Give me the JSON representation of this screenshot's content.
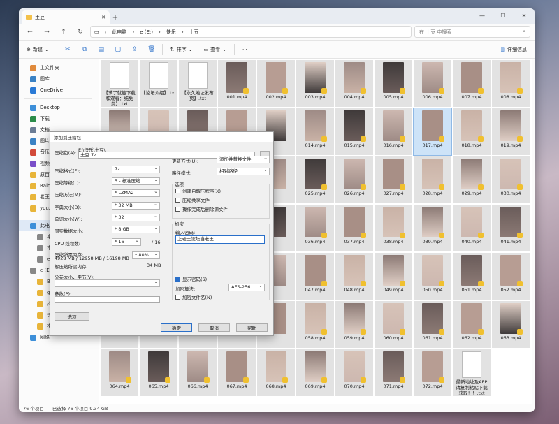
{
  "window": {
    "tab_title": "土豆",
    "new_tab": "+",
    "min": "—",
    "max": "☐",
    "close": "✕"
  },
  "address": {
    "crumbs": [
      "此电脑",
      "e (E:)",
      "快乐",
      "土豆"
    ],
    "search_placeholder": "在 土豆 中搜索"
  },
  "toolbar": {
    "new_label": "新建",
    "sort_label": "排序",
    "view_label": "查看",
    "more": "···",
    "details_label": "详细信息"
  },
  "sidebar": {
    "items": [
      {
        "label": "主文件夹",
        "color": "#e08a3c",
        "cls": "sitem"
      },
      {
        "label": "图库",
        "color": "#3b82c4",
        "cls": "sitem"
      },
      {
        "label": "OneDrive",
        "color": "#2a7ad6",
        "cls": "sitem sub2"
      },
      {
        "label": "Desktop",
        "color": "#3d8fd9",
        "cls": "sitem"
      },
      {
        "label": "下载",
        "color": "#2b8c4a",
        "cls": "sitem"
      },
      {
        "label": "文档",
        "color": "#6b7c95",
        "cls": "sitem"
      },
      {
        "label": "图片",
        "color": "#3b82c4",
        "cls": "sitem"
      },
      {
        "label": "音乐",
        "color": "#d24a3a",
        "cls": "sitem"
      },
      {
        "label": "视频",
        "color": "#7a4fc9",
        "cls": "sitem"
      },
      {
        "label": "原百",
        "color": "#e8b53a",
        "cls": "sitem"
      },
      {
        "label": "Baidu",
        "color": "#e8b53a",
        "cls": "sitem"
      },
      {
        "label": "老王的",
        "color": "#e8b53a",
        "cls": "sitem"
      },
      {
        "label": "youxi",
        "color": "#e8b53a",
        "cls": "sitem"
      },
      {
        "label": "此电脑",
        "color": "#3d8fd9",
        "cls": "sitem sel"
      },
      {
        "label": "本地磁",
        "color": "#888",
        "cls": "sitem sub"
      },
      {
        "label": "本地磁",
        "color": "#888",
        "cls": "sitem sub"
      },
      {
        "label": "e (E:)",
        "color": "#888",
        "cls": "sitem sub"
      },
      {
        "label": "e (E:)",
        "color": "#888",
        "cls": "sitem sub2"
      },
      {
        "label": "Baid",
        "color": "#e8b53a",
        "cls": "sitem sub"
      },
      {
        "label": "game",
        "color": "#e8b53a",
        "cls": "sitem sub"
      },
      {
        "label": "抖音",
        "color": "#e8b53a",
        "cls": "sitem sub"
      },
      {
        "label": "快乐",
        "color": "#e8b53a",
        "cls": "sitem sub"
      },
      {
        "label": "推特",
        "color": "#e8b53a",
        "cls": "sitem sub"
      },
      {
        "label": "网络",
        "color": "#3d8fd9",
        "cls": "sitem sub2"
      }
    ]
  },
  "files": [
    {
      "name": "【求了就能下载\n和观看：纯免\n费】.txt",
      "kind": "doc"
    },
    {
      "name": "【论坛介绍】.txt",
      "kind": "doc"
    },
    {
      "name": "【永久地址发布\n页】.txt",
      "kind": "doc"
    },
    {
      "name": "001.mp4"
    },
    {
      "name": "002.mp4"
    },
    {
      "name": "003.mp4"
    },
    {
      "name": "004.mp4"
    },
    {
      "name": "005.mp4"
    },
    {
      "name": "006.mp4"
    },
    {
      "name": "007.mp4"
    },
    {
      "name": "008.mp4"
    },
    {
      "name": ""
    },
    {
      "name": ""
    },
    {
      "name": ""
    },
    {
      "name": ""
    },
    {
      "name": ""
    },
    {
      "name": "014.mp4"
    },
    {
      "name": "015.mp4"
    },
    {
      "name": "016.mp4"
    },
    {
      "name": "017.mp4",
      "selected": true
    },
    {
      "name": "018.mp4"
    },
    {
      "name": "019.mp4"
    },
    {
      "name": ""
    },
    {
      "name": ""
    },
    {
      "name": ""
    },
    {
      "name": ""
    },
    {
      "name": ""
    },
    {
      "name": "025.mp4"
    },
    {
      "name": "026.mp4"
    },
    {
      "name": "027.mp4"
    },
    {
      "name": "028.mp4"
    },
    {
      "name": "029.mp4"
    },
    {
      "name": "030.mp4"
    },
    {
      "name": ""
    },
    {
      "name": ""
    },
    {
      "name": ""
    },
    {
      "name": ""
    },
    {
      "name": ""
    },
    {
      "name": "036.mp4"
    },
    {
      "name": "037.mp4"
    },
    {
      "name": "038.mp4"
    },
    {
      "name": "039.mp4"
    },
    {
      "name": "040.mp4"
    },
    {
      "name": "041.mp4"
    },
    {
      "name": ""
    },
    {
      "name": ""
    },
    {
      "name": ""
    },
    {
      "name": ""
    },
    {
      "name": ""
    },
    {
      "name": "047.mp4"
    },
    {
      "name": "048.mp4"
    },
    {
      "name": "049.mp4"
    },
    {
      "name": "050.mp4"
    },
    {
      "name": "051.mp4"
    },
    {
      "name": "052.mp4"
    },
    {
      "name": ""
    },
    {
      "name": ""
    },
    {
      "name": ""
    },
    {
      "name": ""
    },
    {
      "name": ""
    },
    {
      "name": "058.mp4"
    },
    {
      "name": "059.mp4"
    },
    {
      "name": "060.mp4"
    },
    {
      "name": "061.mp4"
    },
    {
      "name": "062.mp4"
    },
    {
      "name": "063.mp4"
    },
    {
      "name": "064.mp4"
    },
    {
      "name": "065.mp4"
    },
    {
      "name": "066.mp4"
    },
    {
      "name": "067.mp4"
    },
    {
      "name": "068.mp4"
    },
    {
      "name": "069.mp4"
    },
    {
      "name": "070.mp4"
    },
    {
      "name": "071.mp4"
    },
    {
      "name": "072.mp4"
    },
    {
      "name": "最新地址及APP\n请复制粘贴下载\n获取！！.txt",
      "kind": "doc"
    }
  ],
  "status": {
    "count": "76 个项目",
    "selected": "已选择 76 个项目  9.34 GB"
  },
  "dialog": {
    "title": "添加到压缩包",
    "archive_label": "压缩包(A):",
    "archive_path": "E:\\快乐\\土豆\\",
    "archive_name": "土豆.7z",
    "browse": "...",
    "format_label": "压缩格式(F):",
    "format_value": "7z",
    "level_label": "压缩等级(L):",
    "level_value": "5 - 标准压缩",
    "method_label": "压缩方法(M):",
    "method_value": "* LZMA2",
    "dict_label": "字典大小(D):",
    "dict_value": "* 32 MB",
    "word_label": "单词大小(W):",
    "word_value": "* 32",
    "solid_label": "固实数据大小:",
    "solid_value": "* 8 GB",
    "cpu_label": "CPU 线程数:",
    "cpu_value": "* 16",
    "cpu_total": "/ 16",
    "mem_label": "压缩所需内存:",
    "mem_detail": "4928 MB / 12958 MB / 16198 MB",
    "mem_pct": "* 80%",
    "dmem_label": "解压缩所需内存:",
    "dmem_value": "34 MB",
    "split_label": "分卷大小，字节(V):",
    "params_label": "参数(P):",
    "options_btn": "选项",
    "update_label": "更新方式(U):",
    "update_value": "添加并替换文件",
    "path_label": "路径模式:",
    "path_value": "相对路径",
    "opts_title": "选项",
    "opt1": "创建自解压程序(X)",
    "opt2": "压缩共享文件",
    "opt3": "操作完成后删除源文件",
    "enc_title": "加密",
    "pwd_label": "输入密码:",
    "pwd_value": "上老王论坛当老王",
    "show_pwd": "显示密码(S)",
    "enc_method_label": "加密算法:",
    "enc_method_value": "AES-256",
    "enc_names": "加密文件名(N)",
    "ok": "确定",
    "cancel": "取消",
    "help": "帮助"
  }
}
